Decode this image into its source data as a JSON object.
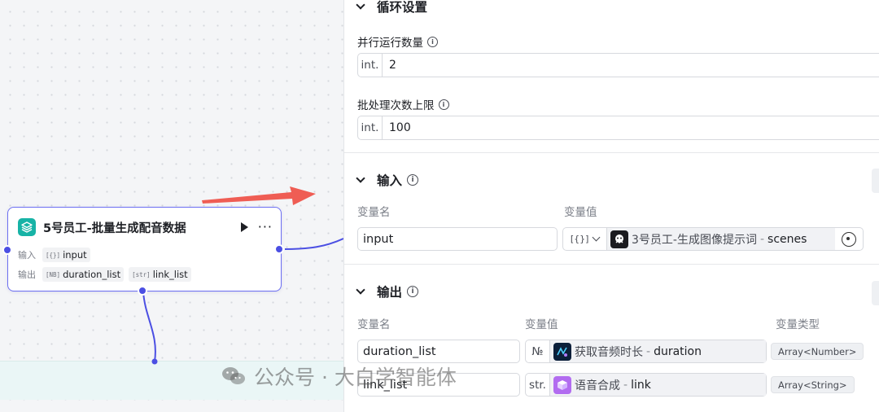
{
  "node": {
    "title": "5号员工-批量生成配音数据",
    "input_label": "输入",
    "output_label": "输出",
    "inputs": [
      {
        "type_icon": "[{}]",
        "name": "input"
      }
    ],
    "outputs": [
      {
        "type_icon": "[NB]",
        "name": "duration_list"
      },
      {
        "type_icon": "[str]",
        "name": "link_list"
      }
    ]
  },
  "panel": {
    "loop_section_title": "循环设置",
    "parallel_label": "并行运行数量",
    "parallel_prefix": "int.",
    "parallel_value": "2",
    "batch_label": "批处理次数上限",
    "batch_prefix": "int.",
    "batch_value": "100",
    "input_section_title": "输入",
    "input_col_name": "变量名",
    "input_col_value": "变量值",
    "input_row": {
      "name": "input",
      "type": "[{}]",
      "ref_node": "3号员工-生成图像提示词",
      "ref_sep": "-",
      "ref_var": "scenes"
    },
    "output_section_title": "输出",
    "output_col_name": "变量名",
    "output_col_value": "变量值",
    "output_col_type": "变量类型",
    "output_rows": [
      {
        "name": "duration_list",
        "type": "№",
        "ref_node": "获取音频时长",
        "ref_sep": "-",
        "ref_var": "duration",
        "var_type": "Array<Number>"
      },
      {
        "name": "link_list",
        "type": "str.",
        "ref_node": "语音合成",
        "ref_sep": "-",
        "ref_var": "link",
        "var_type": "Array<String>"
      }
    ]
  },
  "watermark": "公众号 · 大白学智能体",
  "colors": {
    "accent": "#4b4fe3",
    "arrow": "#ef5d54",
    "node_icon": "#17b3a6"
  }
}
